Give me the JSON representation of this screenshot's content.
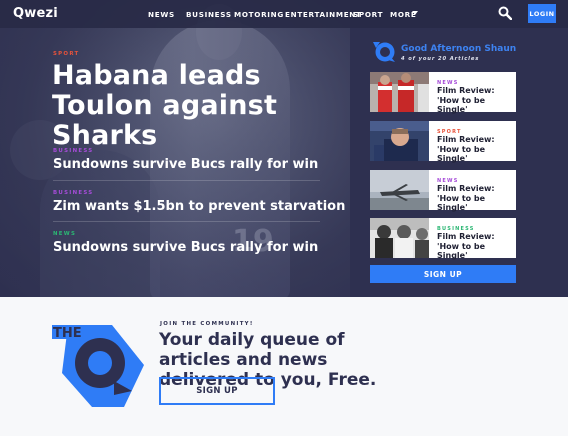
{
  "brand": {
    "logo_text": "Qwezi",
    "accent_color": "#2f7cf6",
    "nav_bg": "#282a46"
  },
  "nav": {
    "items": [
      "NEWS",
      "BUSINESS",
      "MOTORING",
      "ENTERTAINMENT",
      "SPORT",
      "MORE"
    ],
    "search_icon": "search-icon",
    "login_label": "LOGIN"
  },
  "hero": {
    "category": "SPORT",
    "category_color": "#e8533b",
    "title": "Habana leads Toulon against Sharks",
    "jersey_number": "19"
  },
  "stories": [
    {
      "category": "BUSINESS",
      "category_color": "#a64cd8",
      "title": "Sundowns survive Bucs rally for win"
    },
    {
      "category": "BUSINESS",
      "category_color": "#a64cd8",
      "title": "Zim wants $1.5bn to prevent starvation"
    },
    {
      "category": "NEWS",
      "category_color": "#2bb673",
      "title": "Sundowns survive Bucs rally for win"
    }
  ],
  "sidebar": {
    "greeting": "Good Afternoon Shaun",
    "subtitle": "4 of your 20 Articles",
    "cards": [
      {
        "category": "NEWS",
        "category_color": "#a64cd8",
        "title": "Film Review: 'How to be Single'"
      },
      {
        "category": "SPORT",
        "category_color": "#e8533b",
        "title": "Film Review: 'How to be Single'"
      },
      {
        "category": "NEWS",
        "category_color": "#a64cd8",
        "title": "Film Review: 'How to be Single'"
      },
      {
        "category": "BUSINESS",
        "category_color": "#2bb673",
        "title": "Film Review: 'How to be Single'"
      }
    ],
    "signup_label": "SIGN UP"
  },
  "promo": {
    "graphic_text": "THE",
    "kicker": "JOIN THE COMMUNITY!",
    "title": "Your daily queue of articles and news delivered to you, Free.",
    "button_label": "SIGN UP"
  }
}
